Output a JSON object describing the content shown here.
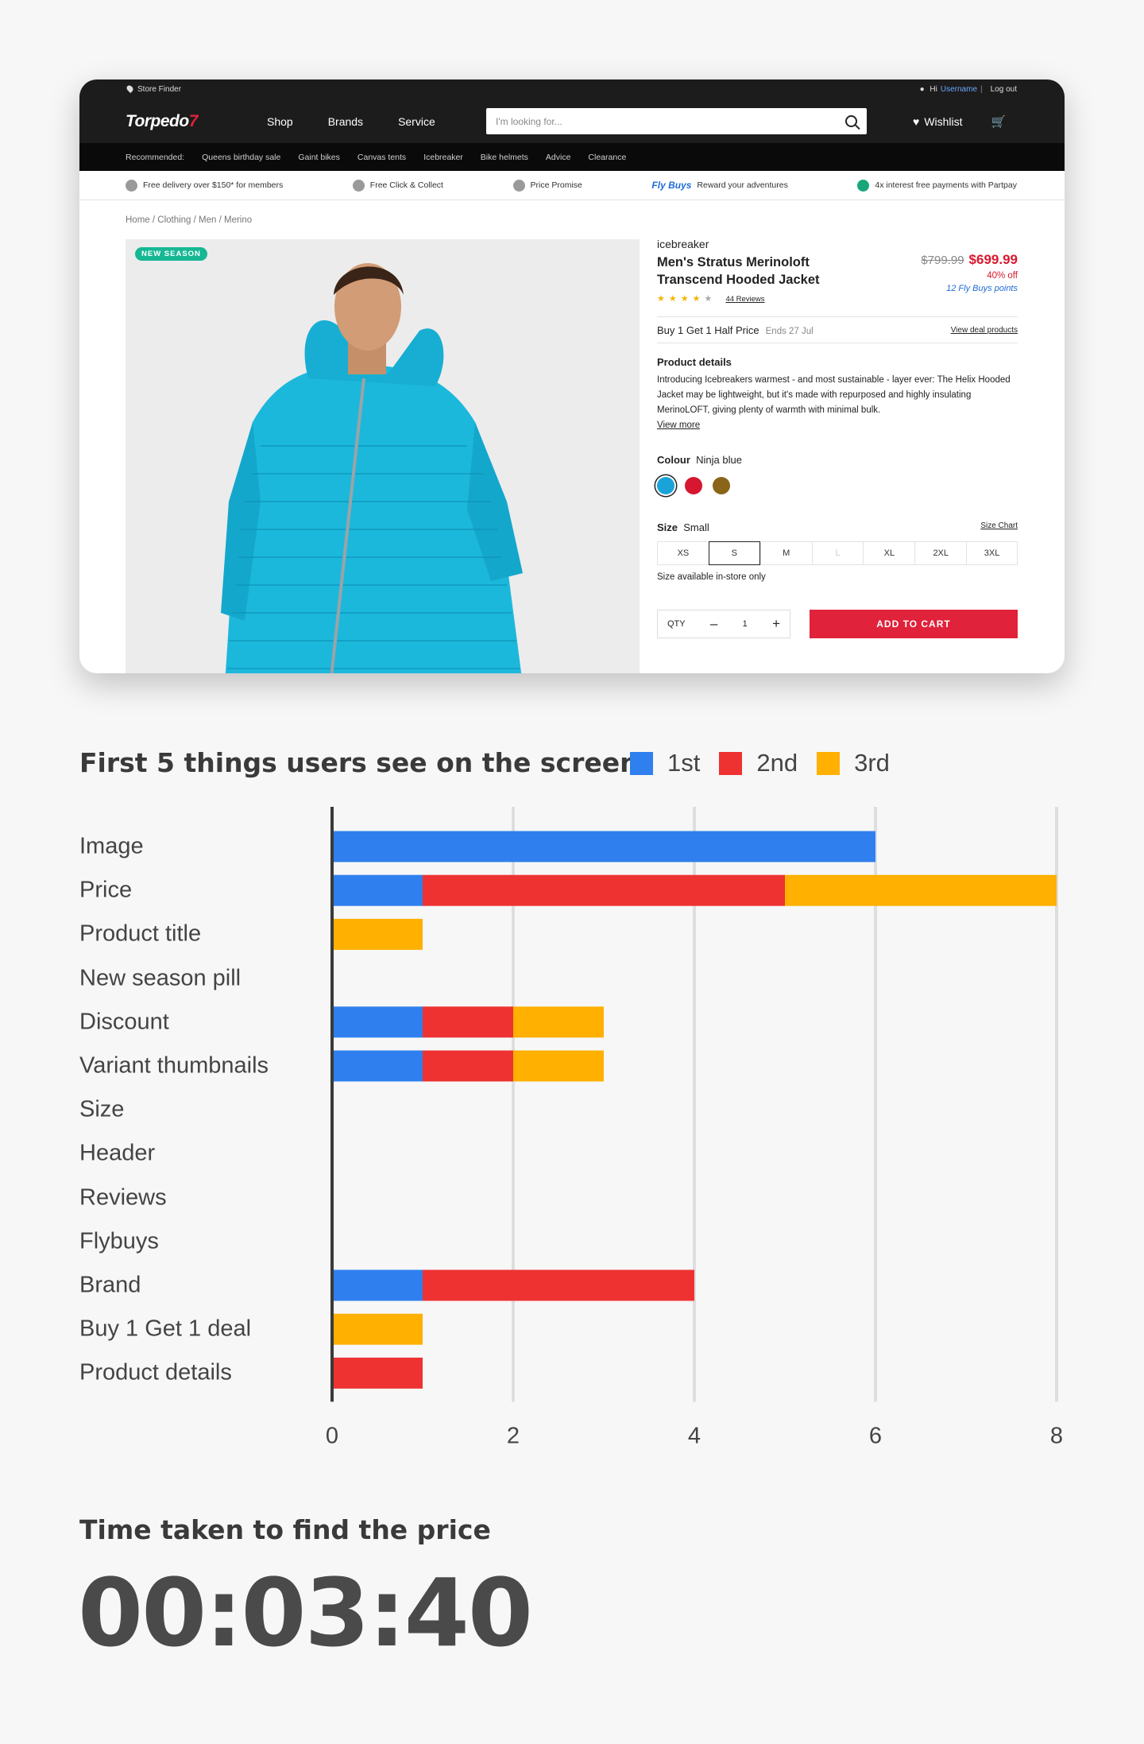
{
  "screenshot": {
    "utility": {
      "store_finder": "Store Finder",
      "greeting": "Hi",
      "username": "Username",
      "logout": "Log out"
    },
    "nav": {
      "logo_main": "Torpedo",
      "logo_mark": "7",
      "links": [
        "Shop",
        "Brands",
        "Service"
      ],
      "search_placeholder": "I'm looking for...",
      "wishlist": "Wishlist"
    },
    "recommended": {
      "label": "Recommended:",
      "items": [
        "Queens birthday sale",
        "Gaint bikes",
        "Canvas tents",
        "Icebreaker",
        "Bike helmets",
        "Advice",
        "Clearance"
      ]
    },
    "perks": [
      "Free delivery over $150* for members",
      "Free Click & Collect",
      "Price Promise",
      "Reward your adventures",
      "4x interest free payments with Partpay"
    ],
    "flybuys_mark": "Fly Buys",
    "breadcrumb": "Home / Clothing / Men / Merino",
    "pill": "NEW SEASON",
    "product": {
      "brand": "icebreaker",
      "title": "Men's Stratus Merinoloft Transcend Hooded Jacket",
      "was_price": "$799.99",
      "price": "$699.99",
      "discount": "40% off",
      "flybuys_count": "12",
      "flybuys_label": "Fly Buys points",
      "reviews": "44 Reviews",
      "rating": 4,
      "deal": "Buy 1 Get 1 Half Price",
      "deal_ends": "Ends 27 Jul",
      "deal_link": "View deal products",
      "details_heading": "Product details",
      "details_text": "Introducing Icebreakers warmest - and most sustainable - layer ever: The Helix Hooded Jacket may be lightweight, but it's made with repurposed and highly insulating MerinoLOFT, giving plenty of warmth with minimal bulk.",
      "view_more": "View more",
      "colour_label": "Colour",
      "colour_value": "Ninja blue",
      "swatches": [
        "#1aa3d8",
        "#d6172f",
        "#8a6418"
      ],
      "size_label": "Size",
      "size_value": "Small",
      "size_chart": "Size Chart",
      "sizes": [
        "XS",
        "S",
        "M",
        "L",
        "XL",
        "2XL",
        "3XL"
      ],
      "availability": "Size available in-store only",
      "qty_label": "QTY",
      "qty_value": "1",
      "add_to_cart": "ADD TO CART"
    }
  },
  "chart_title": "First 5 things users see on the screen",
  "chart_data": {
    "type": "bar",
    "orientation": "horizontal",
    "stacked": true,
    "categories": [
      "Image",
      "Price",
      "Product title",
      "New season pill",
      "Discount",
      "Variant thumbnails",
      "Size",
      "Header",
      "Reviews",
      "Flybuys",
      "Brand",
      "Buy 1 Get 1 deal",
      "Product details"
    ],
    "series": [
      {
        "name": "1st",
        "color": "#2f7fee",
        "values": [
          6,
          1,
          0,
          0,
          1,
          1,
          0,
          0,
          0,
          0,
          1,
          0,
          0
        ]
      },
      {
        "name": "2nd",
        "color": "#ee3232",
        "values": [
          0,
          4,
          0,
          0,
          1,
          1,
          0,
          0,
          0,
          0,
          3,
          0,
          1
        ]
      },
      {
        "name": "3rd",
        "color": "#ffb000",
        "values": [
          0,
          3,
          1,
          0,
          1,
          1,
          0,
          0,
          0,
          0,
          0,
          1,
          0
        ]
      }
    ],
    "xlim": [
      0,
      8
    ],
    "xticks": [
      "0",
      "2",
      "4",
      "6",
      "8"
    ],
    "grid": true,
    "legend": "top-right"
  },
  "time_section": {
    "title": "Time taken to find the price",
    "value": "00:03:40"
  }
}
